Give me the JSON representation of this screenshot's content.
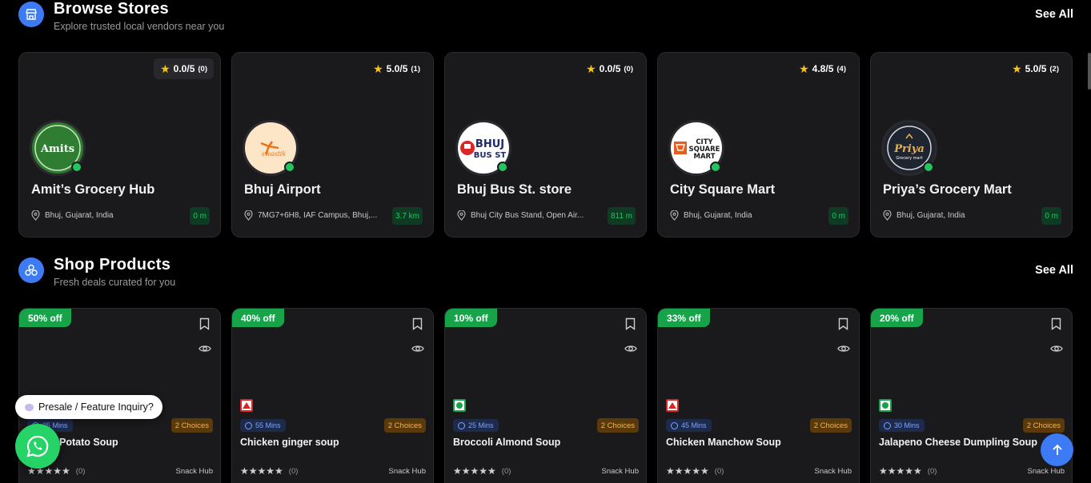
{
  "browse_stores": {
    "title": "Browse Stores",
    "subtitle": "Explore trusted local vendors near you",
    "see_all": "See All",
    "stores": [
      {
        "name": "Amit’s Grocery Hub",
        "rating": "0.0/5",
        "count": "(0)",
        "address": "Bhuj, Gujarat, India",
        "distance": "0 m",
        "logo_text": "Amits",
        "logo_bg": "#2f7d32"
      },
      {
        "name": "Bhuj Airport",
        "rating": "5.0/5",
        "count": "(1)",
        "address": "7MG7+6H8, IAF Campus, Bhuj,...",
        "distance": "3.7 km",
        "logo_text": "swastik",
        "logo_bg": "#fde5c8"
      },
      {
        "name": "Bhuj Bus St. store",
        "rating": "0.0/5",
        "count": "(0)",
        "address": "Bhuj City Bus Stand, Open Air...",
        "distance": "811 m",
        "logo_text": "BHUJ BUS ST",
        "logo_bg": "#ffffff"
      },
      {
        "name": "City Square Mart",
        "rating": "4.8/5",
        "count": "(4)",
        "address": "Bhuj, Gujarat, India",
        "distance": "0 m",
        "logo_text": "CITY SQUARE MART",
        "logo_bg": "#ffffff"
      },
      {
        "name": "Priya’s Grocery Mart",
        "rating": "5.0/5",
        "count": "(2)",
        "address": "Bhuj, Gujarat, India",
        "distance": "0 m",
        "logo_text": "Priya",
        "logo_bg": "#1f2530"
      }
    ]
  },
  "shop_products": {
    "title": "Shop Products",
    "subtitle": "Fresh deals curated for you",
    "see_all": "See All",
    "products": [
      {
        "discount": "50% off",
        "type": "veg",
        "time": "25 Mins",
        "choices": "2 Choices",
        "name": "Potato Soup",
        "rating_count": "(0)",
        "vendor": "Snack Hub"
      },
      {
        "discount": "40% off",
        "type": "nonveg",
        "time": "55 Mins",
        "choices": "2 Choices",
        "name": "Chicken ginger soup",
        "rating_count": "(0)",
        "vendor": "Snack Hub"
      },
      {
        "discount": "10% off",
        "type": "veg",
        "time": "25 Mins",
        "choices": "2 Choices",
        "name": "Broccoli Almond Soup",
        "rating_count": "(0)",
        "vendor": "Snack Hub"
      },
      {
        "discount": "33% off",
        "type": "nonveg",
        "time": "45 Mins",
        "choices": "2 Choices",
        "name": "Chicken Manchow Soup",
        "rating_count": "(0)",
        "vendor": "Snack Hub"
      },
      {
        "discount": "20% off",
        "type": "veg",
        "time": "30 Mins",
        "choices": "2 Choices",
        "name": "Jalapeno Cheese Dumpling Soup",
        "rating_count": "(0)",
        "vendor": "Snack Hub"
      }
    ]
  },
  "presale_label": "Presale / Feature Inquiry?",
  "colors": {
    "accent": "#3d7bf5",
    "online": "#22c55e",
    "discount": "#16a34a",
    "whatsapp": "#25d366"
  }
}
